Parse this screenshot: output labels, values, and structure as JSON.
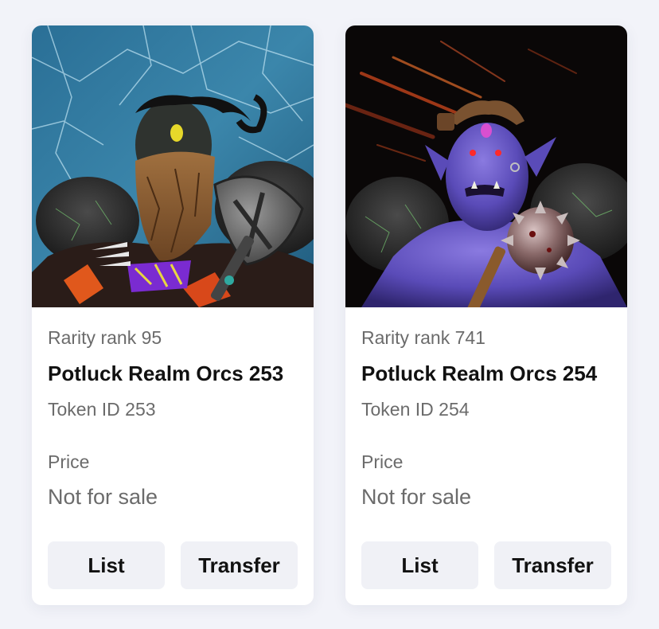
{
  "cards": [
    {
      "rarity": "Rarity rank 95",
      "name": "Potluck Realm Orcs 253",
      "token": "Token ID 253",
      "price_label": "Price",
      "price_value": "Not for sale",
      "list_label": "List",
      "transfer_label": "Transfer"
    },
    {
      "rarity": "Rarity rank 741",
      "name": "Potluck Realm Orcs 254",
      "token": "Token ID 254",
      "price_label": "Price",
      "price_value": "Not for sale",
      "list_label": "List",
      "transfer_label": "Transfer"
    }
  ],
  "colors": {
    "page_background": "#f2f3f9",
    "card_background": "#ffffff",
    "button_background": "#f0f1f6",
    "muted_text": "#6b6b6b",
    "strong_text": "#111111"
  }
}
